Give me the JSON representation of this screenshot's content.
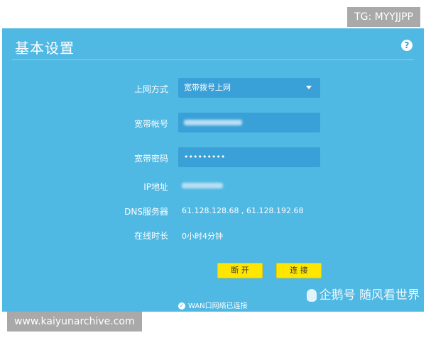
{
  "badges": {
    "tg": "TG: MYYJJPP",
    "site": "www.kaiyunarchive.com"
  },
  "panel": {
    "title": "基本设置",
    "help": "?"
  },
  "form": {
    "mode_label": "上网方式",
    "mode_value": "宽带拨号上网",
    "account_label": "宽带帐号",
    "password_label": "宽带密码",
    "password_value": "•••••••••",
    "ip_label": "IP地址",
    "dns_label": "DNS服务器",
    "dns_value": "61.128.128.68 , 61.128.192.68",
    "uptime_label": "在线时长",
    "uptime_value": "0小时4分钟"
  },
  "buttons": {
    "disconnect": "断 开",
    "connect": "连 接"
  },
  "status": {
    "text": "WAN口网络已连接"
  },
  "watermark": {
    "text": "企鹅号 随风看世界"
  },
  "colors": {
    "panel_bg": "#4fb8e3",
    "field_bg": "#3aa1d8",
    "button_bg": "#ffe600"
  }
}
